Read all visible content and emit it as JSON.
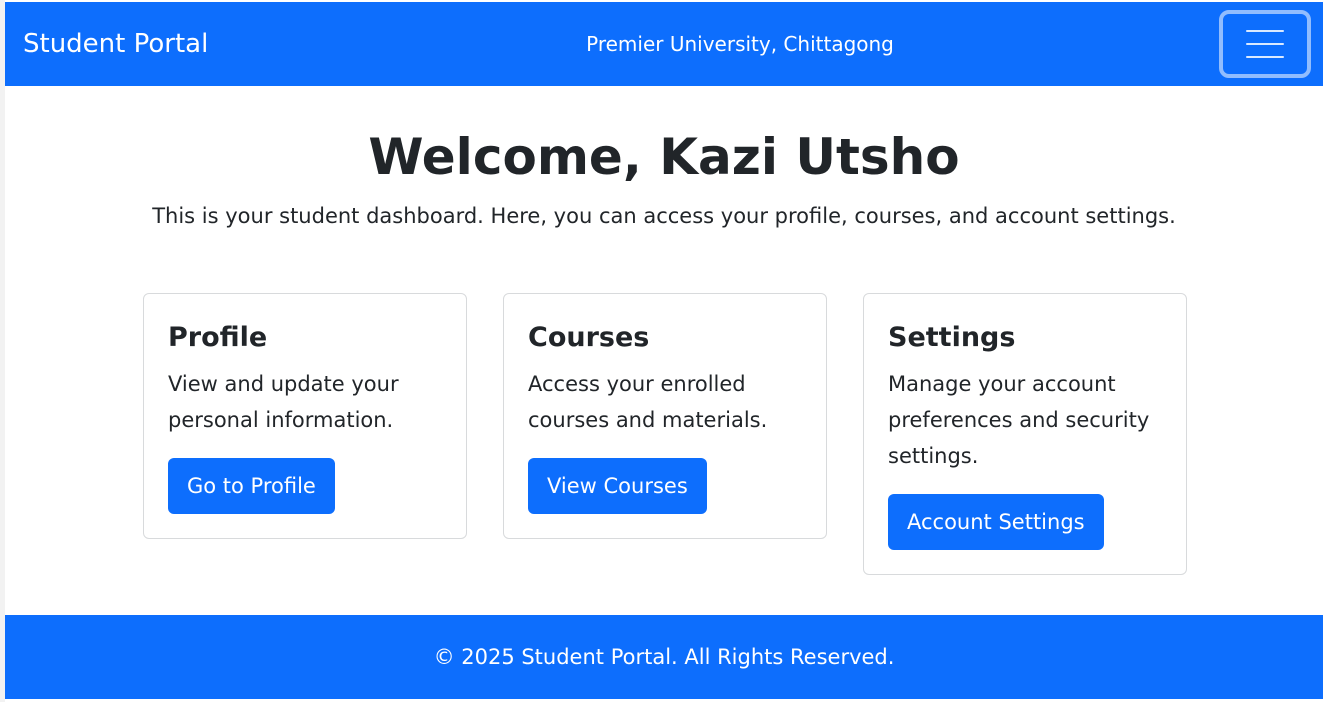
{
  "navbar": {
    "brand": "Student Portal",
    "university": "Premier University, Chittagong",
    "toggler_icon": "hamburger-menu-icon"
  },
  "hero": {
    "title": "Welcome, Kazi Utsho",
    "subtitle": "This is your student dashboard. Here, you can access your profile, courses, and account settings."
  },
  "cards": [
    {
      "title": "Profile",
      "text": "View and update your personal information.",
      "button": "Go to Profile"
    },
    {
      "title": "Courses",
      "text": "Access your enrolled courses and materials.",
      "button": "View Courses"
    },
    {
      "title": "Settings",
      "text": "Manage your account preferences and security settings.",
      "button": "Account Settings"
    }
  ],
  "footer": {
    "text": "© 2025 Student Portal. All Rights Reserved."
  },
  "colors": {
    "primary": "#0d6efd",
    "text": "#212529",
    "border": "#d8dadc"
  }
}
